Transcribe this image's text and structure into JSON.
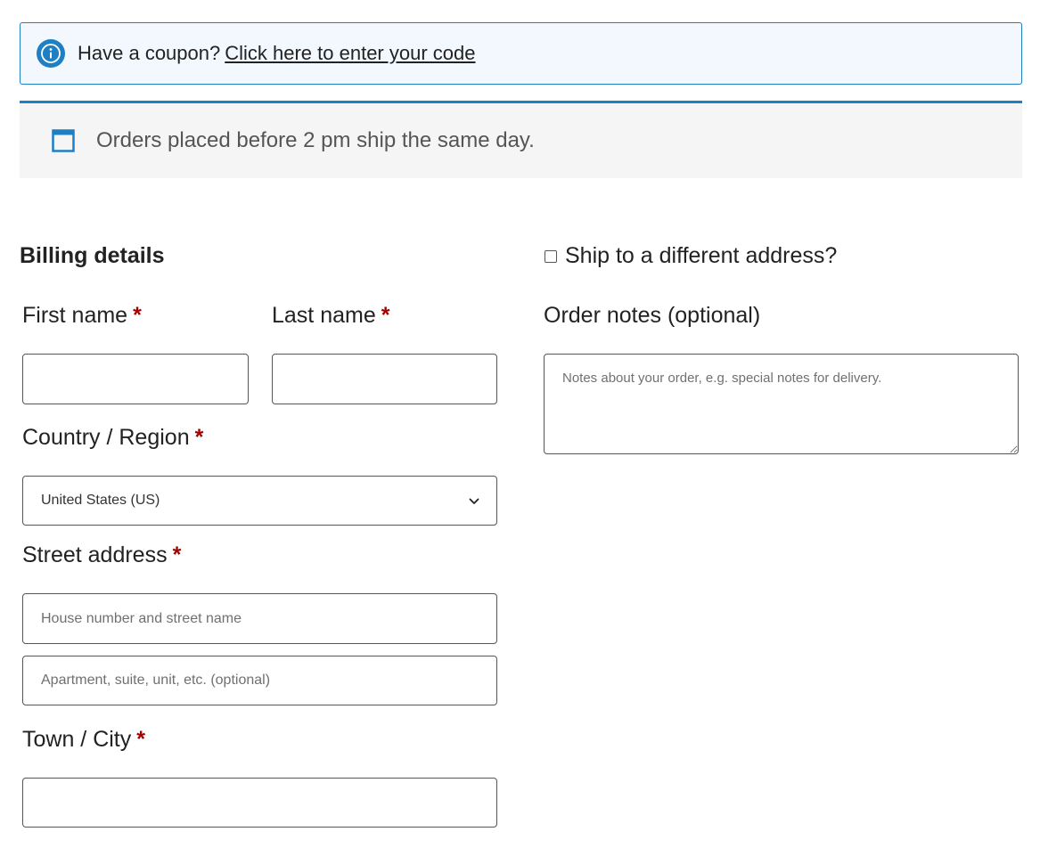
{
  "coupon_notice": {
    "text": "Have a coupon?",
    "link_text": "Click here to enter your code",
    "icon": "info-icon"
  },
  "shipping_notice": {
    "text": "Orders placed before 2 pm ship the same day.",
    "icon": "window-icon"
  },
  "billing": {
    "title": "Billing details",
    "required_marker": "*",
    "first_name": {
      "label": "First name",
      "value": ""
    },
    "last_name": {
      "label": "Last name",
      "value": ""
    },
    "country": {
      "label": "Country / Region",
      "selected": "United States (US)"
    },
    "street": {
      "label": "Street address",
      "line1_placeholder": "House number and street name",
      "line2_placeholder": "Apartment, suite, unit, etc. (optional)"
    },
    "city": {
      "label": "Town / City",
      "value": ""
    }
  },
  "shipping": {
    "checkbox_label": "Ship to a different address?",
    "checked": false
  },
  "order_notes": {
    "label": "Order notes (optional)",
    "placeholder": "Notes about your order, e.g. special notes for delivery."
  },
  "colors": {
    "accent": "#1e7fc2",
    "required": "#a30000",
    "notice_bg": "#f2f8fd",
    "info_bg": "#f5f5f6"
  }
}
